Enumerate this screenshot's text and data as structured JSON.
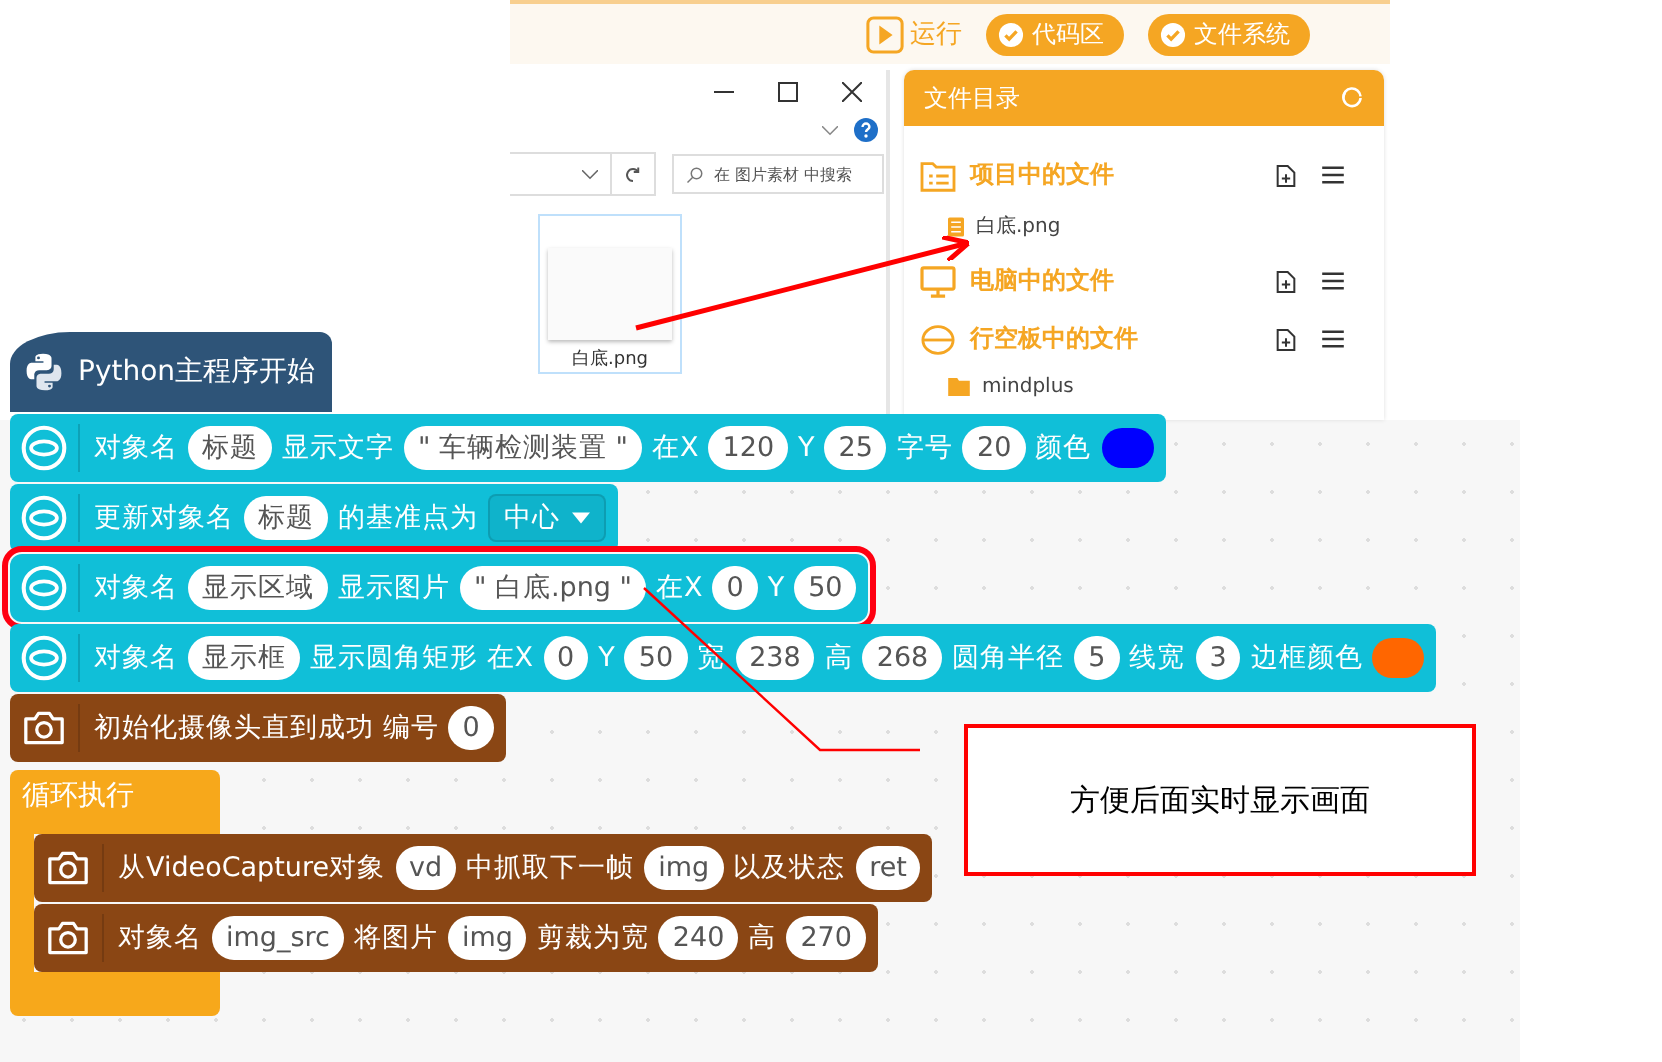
{
  "toolbar": {
    "run": "运行",
    "buttons": [
      {
        "label": "代码区",
        "checked": true
      },
      {
        "label": "文件系统",
        "checked": true
      }
    ]
  },
  "explorer": {
    "search_placeholder": "在 图片素材 中搜索",
    "file": "白底.png"
  },
  "file_panel": {
    "title": "文件目录",
    "sections": [
      {
        "kind": "project",
        "title": "项目中的文件",
        "items": [
          {
            "kind": "file",
            "name": "白底.png"
          }
        ]
      },
      {
        "kind": "computer",
        "title": "电脑中的文件"
      },
      {
        "kind": "board",
        "title": "行空板中的文件",
        "items": [
          {
            "kind": "folder",
            "name": "mindplus"
          }
        ]
      }
    ]
  },
  "blocks": {
    "hat": "Python主程序开始",
    "statements": [
      {
        "kind": "unihiker",
        "highlighted": false,
        "parts": [
          {
            "kind": "text",
            "text": "对象名"
          },
          {
            "kind": "field",
            "text": "标题"
          },
          {
            "kind": "text",
            "text": "显示文字"
          },
          {
            "kind": "field",
            "text": "\" 车辆检测装置 \""
          },
          {
            "kind": "text",
            "text": "在X"
          },
          {
            "kind": "field",
            "text": "120"
          },
          {
            "kind": "text",
            "text": "Y"
          },
          {
            "kind": "field",
            "text": "25"
          },
          {
            "kind": "text",
            "text": "字号"
          },
          {
            "kind": "field",
            "text": "20"
          },
          {
            "kind": "text",
            "text": "颜色"
          },
          {
            "kind": "color",
            "color": "#0000ff"
          }
        ]
      },
      {
        "kind": "unihiker",
        "highlighted": false,
        "parts": [
          {
            "kind": "text",
            "text": "更新对象名"
          },
          {
            "kind": "field",
            "text": "标题"
          },
          {
            "kind": "text",
            "text": "的基准点为"
          },
          {
            "kind": "dropdown",
            "text": "中心"
          }
        ]
      },
      {
        "kind": "unihiker",
        "highlighted": true,
        "parts": [
          {
            "kind": "text",
            "text": "对象名"
          },
          {
            "kind": "field",
            "text": "显示区域"
          },
          {
            "kind": "text",
            "text": "显示图片"
          },
          {
            "kind": "field",
            "text": "\" 白底.png \""
          },
          {
            "kind": "text",
            "text": "在X"
          },
          {
            "kind": "field",
            "text": "0"
          },
          {
            "kind": "text",
            "text": "Y"
          },
          {
            "kind": "field",
            "text": "50"
          }
        ]
      },
      {
        "kind": "unihiker",
        "highlighted": false,
        "parts": [
          {
            "kind": "text",
            "text": "对象名"
          },
          {
            "kind": "field",
            "text": "显示框"
          },
          {
            "kind": "text",
            "text": "显示圆角矩形 在X"
          },
          {
            "kind": "field",
            "text": "0"
          },
          {
            "kind": "text",
            "text": "Y"
          },
          {
            "kind": "field",
            "text": "50"
          },
          {
            "kind": "text",
            "text": "宽"
          },
          {
            "kind": "field",
            "text": "238"
          },
          {
            "kind": "text",
            "text": "高"
          },
          {
            "kind": "field",
            "text": "268"
          },
          {
            "kind": "text",
            "text": "圆角半径"
          },
          {
            "kind": "field",
            "text": "5"
          },
          {
            "kind": "text",
            "text": "线宽"
          },
          {
            "kind": "field",
            "text": "3"
          },
          {
            "kind": "text",
            "text": "边框颜色"
          },
          {
            "kind": "color",
            "color": "#ff6600"
          }
        ]
      },
      {
        "kind": "camera",
        "highlighted": false,
        "parts": [
          {
            "kind": "text",
            "text": "初始化摄像头直到成功 编号"
          },
          {
            "kind": "field",
            "text": "0"
          }
        ]
      }
    ],
    "loop": {
      "label": "循环执行",
      "body": [
        {
          "kind": "camera",
          "highlighted": false,
          "parts": [
            {
              "kind": "text",
              "text": "从VideoCapture对象"
            },
            {
              "kind": "field",
              "text": "vd"
            },
            {
              "kind": "text",
              "text": "中抓取下一帧"
            },
            {
              "kind": "field",
              "text": "img"
            },
            {
              "kind": "text",
              "text": "以及状态"
            },
            {
              "kind": "field",
              "text": "ret"
            }
          ]
        },
        {
          "kind": "camera",
          "highlighted": false,
          "parts": [
            {
              "kind": "text",
              "text": "对象名"
            },
            {
              "kind": "field",
              "text": "img_src"
            },
            {
              "kind": "text",
              "text": "将图片"
            },
            {
              "kind": "field",
              "text": "img"
            },
            {
              "kind": "text",
              "text": "剪裁为宽"
            },
            {
              "kind": "field",
              "text": "240"
            },
            {
              "kind": "text",
              "text": "高"
            },
            {
              "kind": "field",
              "text": "270"
            }
          ]
        }
      ]
    }
  },
  "annotation": "方便后面实时显示画面"
}
